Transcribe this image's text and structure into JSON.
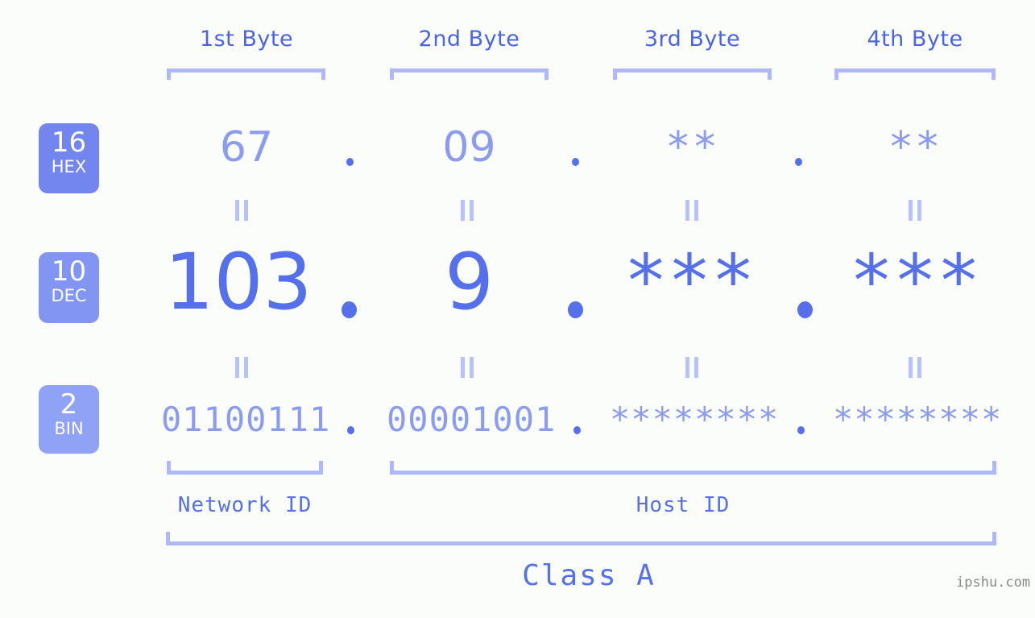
{
  "background_color": "#fbfdfa",
  "colors": {
    "header_blue": "#4a63e8",
    "bracket_lavender": "#aeb8fb",
    "hex_row": "#8b9cf0",
    "dec_row": "#5570ea",
    "bin_row": "#8b9cf0",
    "badge_hex": "#7385ee",
    "badge_dec": "#8295f2",
    "badge_bin": "#8fa2f5",
    "equals_connector": "#b9c3fb",
    "watermark": "#8a8a8a"
  },
  "byte_headers": [
    {
      "label": "1st Byte"
    },
    {
      "label": "2nd Byte"
    },
    {
      "label": "3rd Byte"
    },
    {
      "label": "4th Byte"
    }
  ],
  "rows": [
    {
      "badge": {
        "num": "16",
        "abbr": "HEX"
      },
      "values": [
        "67",
        "09",
        "**",
        "**"
      ],
      "separator": "."
    },
    {
      "badge": {
        "num": "10",
        "abbr": "DEC"
      },
      "values": [
        "103",
        "9",
        "***",
        "***"
      ],
      "separator": "."
    },
    {
      "badge": {
        "num": "2",
        "abbr": "BIN"
      },
      "values": [
        "01100111",
        "00001001",
        "********",
        "********"
      ],
      "separator": "."
    }
  ],
  "equals_marks": "||",
  "sections": {
    "network_id": "Network ID",
    "host_id": "Host ID",
    "class": "Class A"
  },
  "watermark": "ipshu.com"
}
